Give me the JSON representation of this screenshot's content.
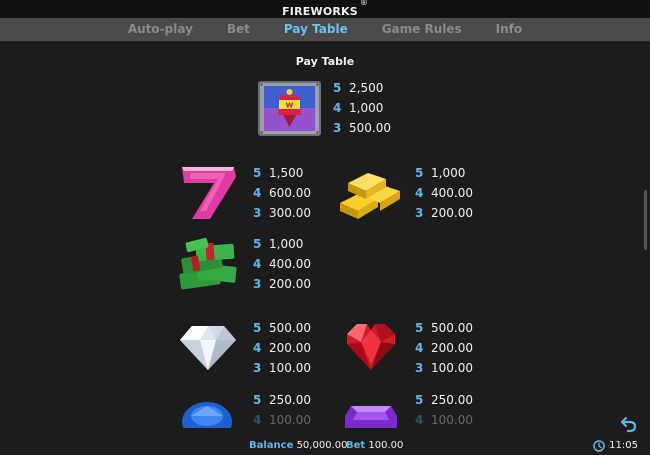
{
  "app": {
    "title": "FIREWORKS",
    "trademark": "®"
  },
  "tabs": [
    {
      "label": "Auto-play"
    },
    {
      "label": "Bet"
    },
    {
      "label": "Pay Table"
    },
    {
      "label": "Game Rules"
    },
    {
      "label": "Info"
    }
  ],
  "active_tab": "Pay Table",
  "paytable": {
    "heading": "Pay Table",
    "symbols": [
      {
        "icon": "firework-rocket-wild-icon",
        "lines": [
          {
            "count": "5",
            "amount": "2,500"
          },
          {
            "count": "4",
            "amount": "1,000"
          },
          {
            "count": "3",
            "amount": "500.00"
          }
        ]
      },
      {
        "icon": "lucky-seven-icon",
        "lines": [
          {
            "count": "5",
            "amount": "1,500"
          },
          {
            "count": "4",
            "amount": "600.00"
          },
          {
            "count": "3",
            "amount": "300.00"
          }
        ]
      },
      {
        "icon": "gold-bars-icon",
        "lines": [
          {
            "count": "5",
            "amount": "1,000"
          },
          {
            "count": "4",
            "amount": "400.00"
          },
          {
            "count": "3",
            "amount": "200.00"
          }
        ]
      },
      {
        "icon": "cash-stacks-icon",
        "lines": [
          {
            "count": "5",
            "amount": "1,000"
          },
          {
            "count": "4",
            "amount": "400.00"
          },
          {
            "count": "3",
            "amount": "200.00"
          }
        ]
      },
      {
        "icon": "diamond-icon",
        "lines": [
          {
            "count": "5",
            "amount": "500.00"
          },
          {
            "count": "4",
            "amount": "200.00"
          },
          {
            "count": "3",
            "amount": "100.00"
          }
        ]
      },
      {
        "icon": "ruby-heart-icon",
        "lines": [
          {
            "count": "5",
            "amount": "500.00"
          },
          {
            "count": "4",
            "amount": "200.00"
          },
          {
            "count": "3",
            "amount": "100.00"
          }
        ]
      },
      {
        "icon": "sapphire-icon",
        "lines": [
          {
            "count": "5",
            "amount": "250.00"
          },
          {
            "count": "4",
            "amount": "100.00"
          }
        ]
      },
      {
        "icon": "amethyst-icon",
        "lines": [
          {
            "count": "5",
            "amount": "250.00"
          },
          {
            "count": "4",
            "amount": "100.00"
          }
        ]
      }
    ]
  },
  "footer": {
    "balance_label": "Balance",
    "balance_value": "50,000.00",
    "bet_label": "Bet",
    "bet_value": "100.00",
    "time": "11:05"
  },
  "colors": {
    "accent": "#5db7ee",
    "background": "#1c1c1c",
    "tab_bar": "#4a4a4a"
  }
}
